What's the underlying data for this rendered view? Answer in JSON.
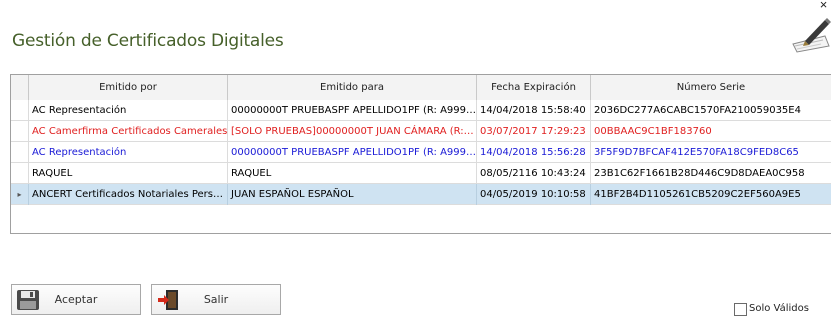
{
  "window": {
    "title": "Gestión de Certificados Digitales",
    "close_symbol": "×"
  },
  "grid": {
    "headers": [
      "Emitido por",
      "Emitido para",
      "Fecha Expiración",
      "Número Serie"
    ],
    "selected_row_marker": "▸",
    "rows": [
      {
        "emitido_por": "AC Representación",
        "emitido_para": "00000000T PRUEBASPF APELLIDO1PF (R: A999…",
        "fecha": "14/04/2018 15:58:40",
        "serie": "2036DC277A6CABC1570FA210059035E4",
        "color": "#000000"
      },
      {
        "emitido_por": "AC Camerfirma Certificados Camerales",
        "emitido_para": "[SOLO PRUEBAS]00000000T JUAN CÁMARA (R:…",
        "fecha": "03/07/2017 17:29:23",
        "serie": "00BBAAC9C1BF183760",
        "color": "#e02020"
      },
      {
        "emitido_por": "AC Representación",
        "emitido_para": "00000000T PRUEBASPF APELLIDO1PF (R: A999…",
        "fecha": "14/04/2018 15:56:28",
        "serie": "3F5F9D7BFCAF412E570FA18C9FED8C65",
        "color": "#1a1ad6"
      },
      {
        "emitido_por": "RAQUEL",
        "emitido_para": "RAQUEL",
        "fecha": "08/05/2116 10:43:24",
        "serie": "23B1C62F1661B28D446C9D8DAEA0C958",
        "color": "#000000"
      },
      {
        "emitido_por": "ANCERT Certificados Notariales Pers…",
        "emitido_para": "JUAN ESPAÑOL ESPAÑOL",
        "fecha": "04/05/2019 10:10:58",
        "serie": "41BF2B4D1105261CB5209C2EF560A9E5",
        "color": "#000000",
        "selected": true
      }
    ]
  },
  "buttons": {
    "aceptar": "Aceptar",
    "salir": "Salir"
  },
  "filter": {
    "solo_validos_label": "Solo Válidos",
    "checked": false
  }
}
